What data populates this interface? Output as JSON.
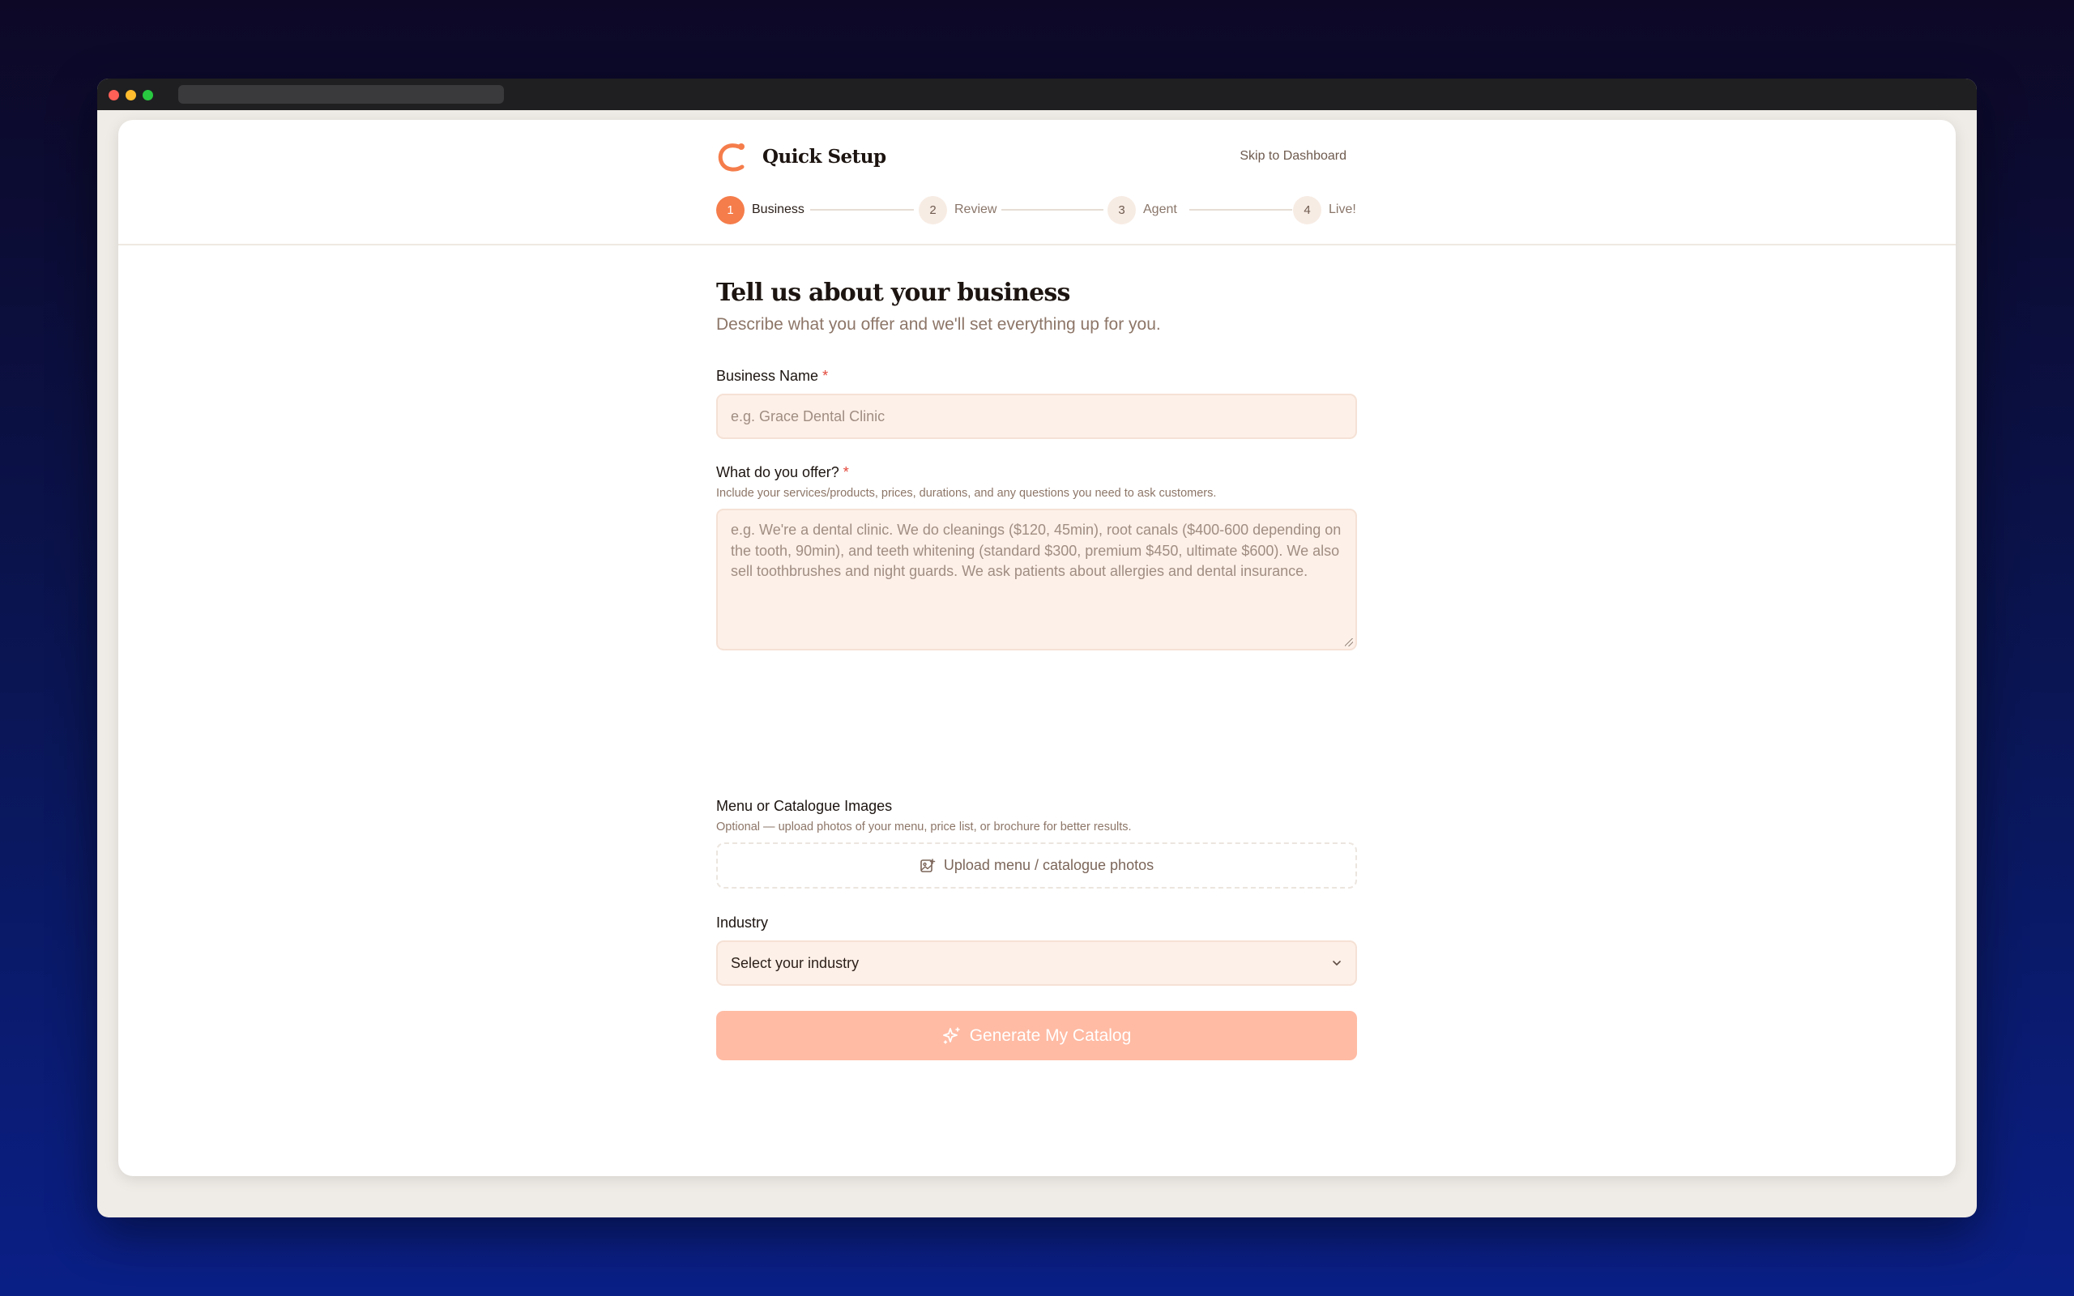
{
  "header": {
    "brand_title": "Quick Setup",
    "skip_link": "Skip to Dashboard"
  },
  "stepper": {
    "steps": [
      {
        "num": "1",
        "label": "Business",
        "active": true
      },
      {
        "num": "2",
        "label": "Review",
        "active": false
      },
      {
        "num": "3",
        "label": "Agent",
        "active": false
      },
      {
        "num": "4",
        "label": "Live!",
        "active": false
      }
    ]
  },
  "form": {
    "title": "Tell us about your business",
    "subtitle": "Describe what you offer and we'll set everything up for you.",
    "business_name": {
      "label": "Business Name",
      "required_mark": "*",
      "placeholder": "e.g. Grace Dental Clinic",
      "value": ""
    },
    "offer": {
      "label": "What do you offer?",
      "required_mark": "*",
      "help": "Include your services/products, prices, durations, and any questions you need to ask customers.",
      "placeholder": "e.g. We're a dental clinic. We do cleanings ($120, 45min), root canals ($400-600 depending on the tooth, 90min), and teeth whitening (standard $300, premium $450, ultimate $600). We also sell toothbrushes and night guards. We ask patients about allergies and dental insurance."
    },
    "images": {
      "label": "Menu or Catalogue Images",
      "help": "Optional — upload photos of your menu, price list, or brochure for better results.",
      "upload_label": "Upload menu / catalogue photos"
    },
    "industry": {
      "label": "Industry",
      "selected": "Select your industry"
    },
    "generate_button": "Generate My Catalog"
  },
  "colors": {
    "accent": "#f57d4b",
    "button_disabled": "#ffbba4",
    "input_bg": "#fdf0e8"
  }
}
